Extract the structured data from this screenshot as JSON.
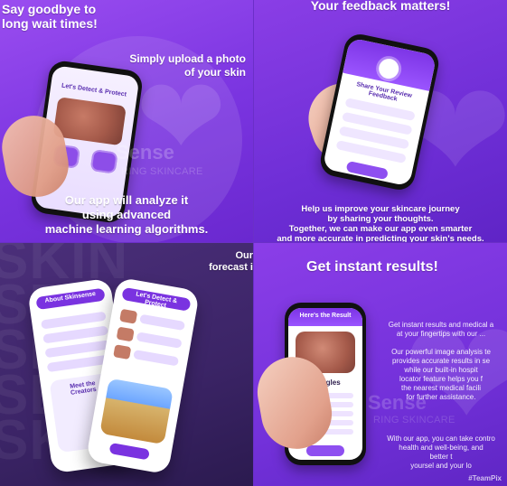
{
  "panels": {
    "p1": {
      "top_text": "Say goodbye to\nlong wait times!",
      "mid_text": "Simply upload a photo\nof your skin",
      "phone_title": "Let's Detect & Protect",
      "brand_text": "Sense",
      "brand_sub": "RING SKINCARE",
      "bottom_text": "Our app will analyze it\nusing advanced\nmachine learning algorithms."
    },
    "p2": {
      "title": "Your feedback matters!",
      "form_title": "Share Your Review\nFeedback",
      "body": "Help us improve your skincare journey\nby sharing your thoughts.\nTogether, we can make our app even smarter\nand more accurate in predicting your skin's needs."
    },
    "p3": {
      "right_text": "Our\nforecast i",
      "phoneA_title": "About Skinsense",
      "phoneA_subtitle": "Meet the Creators",
      "phoneB_title": "Let's Detect & Protect"
    },
    "p4": {
      "title": "Get instant results!",
      "phone_header": "Here's the Result",
      "phone_label": "Shingles",
      "p_a": "Get instant results and medical a\nat your fingertips with our ...",
      "p_b": "Our powerful image analysis te\nprovides accurate results in se\nwhile our built-in hospit\nlocator feature helps you f\nthe nearest medical facili\nfor further assistance.",
      "brand_text": "Sense",
      "brand_sub": "RING SKINCARE",
      "p_c": "With our app, you can take contro\nhealth and well-being, and\nbetter t\nyoursel and your lo",
      "tag": "#TeamPix"
    }
  }
}
